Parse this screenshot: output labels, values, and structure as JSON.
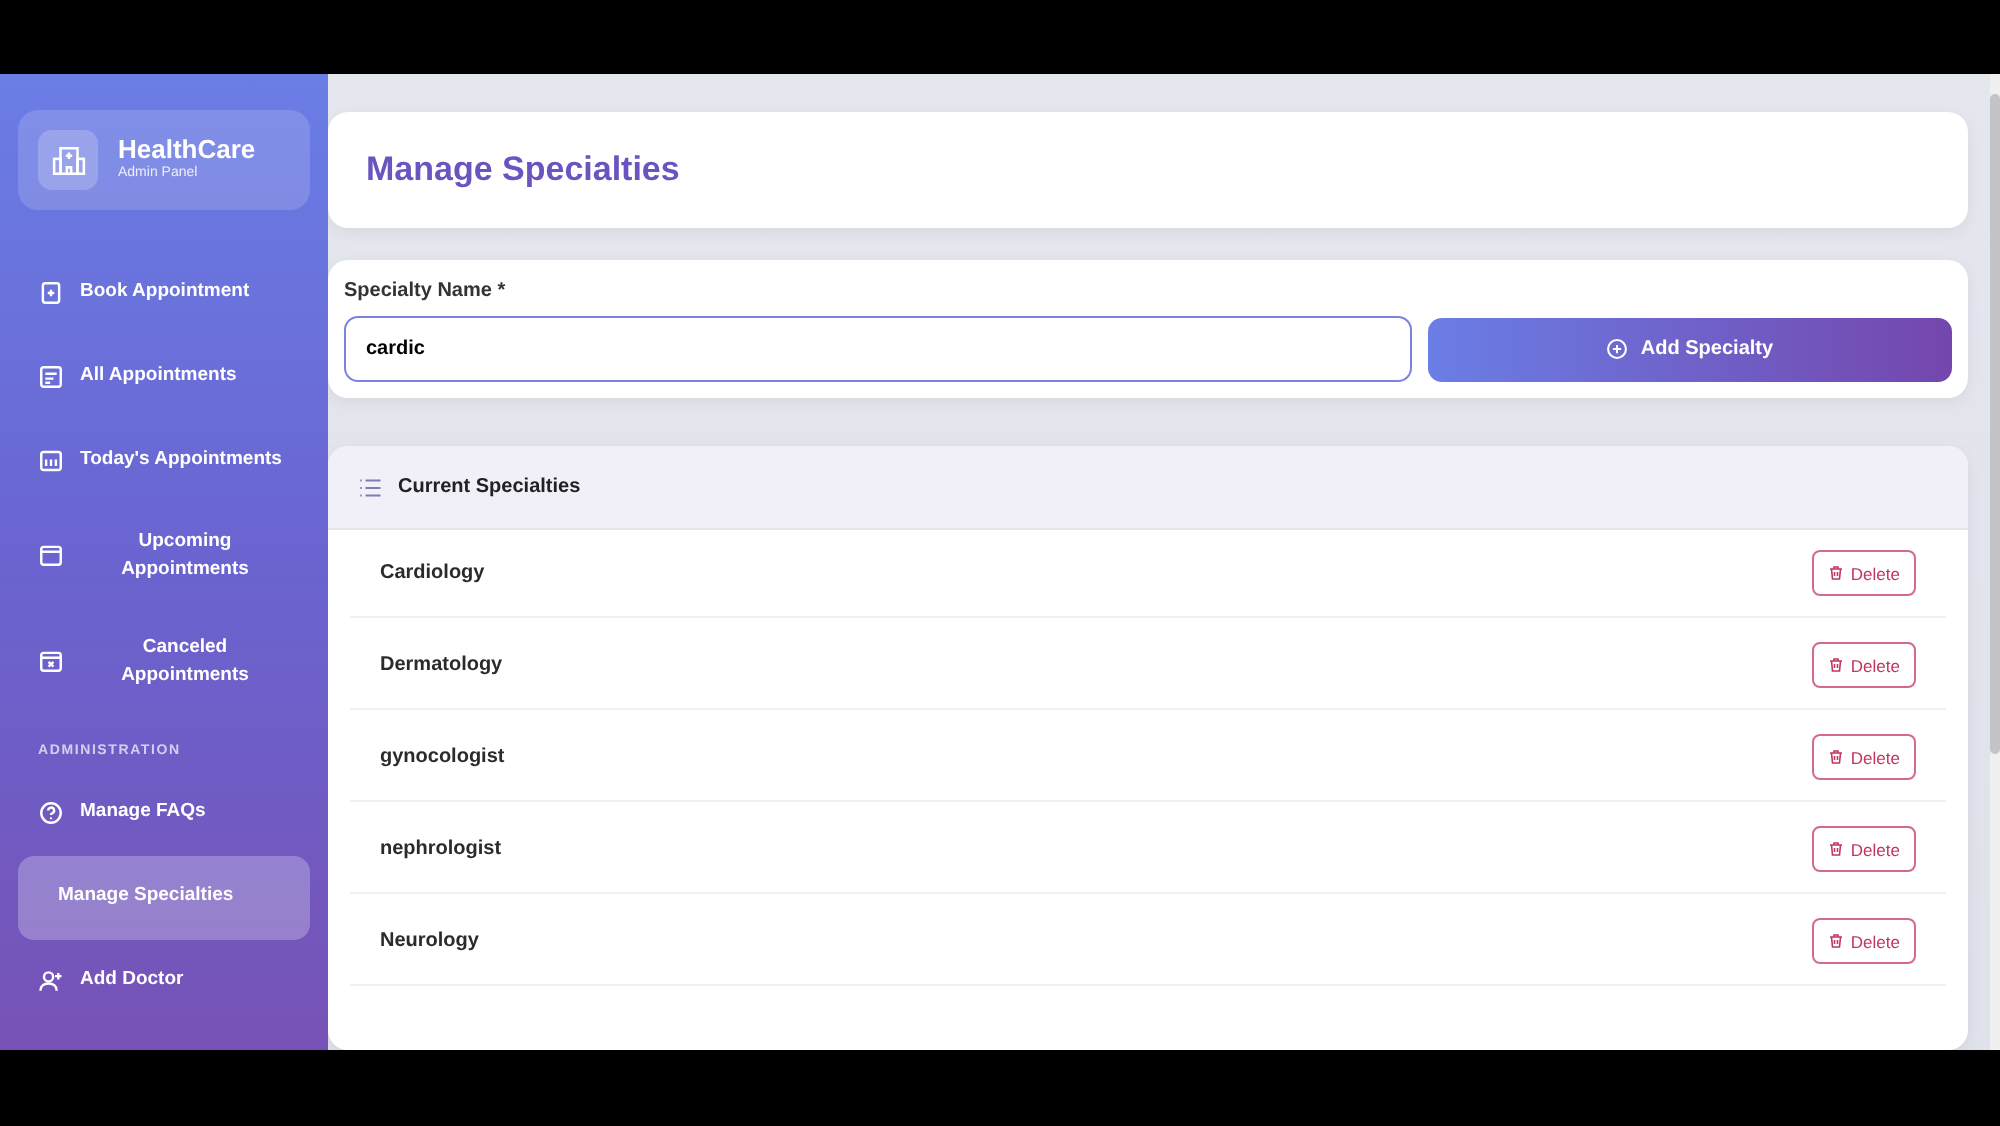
{
  "brand": {
    "title": "HealthCare",
    "subtitle": "Admin Panel"
  },
  "nav": [
    {
      "label": "Book Appointment",
      "kind": "book",
      "selected": false
    },
    {
      "label": "All Appointments",
      "kind": "list",
      "selected": false
    },
    {
      "label": "Today's Appointments",
      "kind": "today",
      "selected": false
    },
    {
      "label": "Upcoming Appointments",
      "kind": "calendar",
      "selected": false
    },
    {
      "label": "Canceled Appointments",
      "kind": "cancel",
      "selected": false
    }
  ],
  "section_label": "ADMINISTRATION",
  "admin_nav": [
    {
      "label": "Manage FAQs",
      "kind": "question",
      "selected": false
    },
    {
      "label": "Manage Specialties",
      "kind": "none",
      "selected": true
    },
    {
      "label": "Add Doctor",
      "kind": "user-add",
      "selected": false
    }
  ],
  "page_title": "Manage Specialties",
  "form": {
    "label": "Specialty Name *",
    "value": "cardic",
    "button": "Add Specialty"
  },
  "list": {
    "title": "Current Specialties",
    "items": [
      {
        "name": "Cardiology",
        "action": "Delete"
      },
      {
        "name": "Dermatology",
        "action": "Delete"
      },
      {
        "name": "gynocologist",
        "action": "Delete"
      },
      {
        "name": "nephrologist",
        "action": "Delete"
      },
      {
        "name": "Neurology",
        "action": "Delete"
      }
    ]
  }
}
